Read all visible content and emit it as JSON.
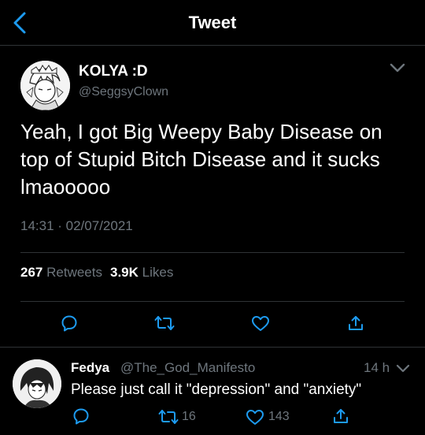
{
  "header": {
    "title": "Tweet"
  },
  "tweet": {
    "author_name": "KOLYA :D",
    "author_handle": "@SeggsyClown",
    "text": "Yeah, I got Big Weepy Baby Disease on top of Stupid Bitch Disease and it sucks lmaooooo",
    "time": "14:31 · 02/07/2021",
    "retweets_count": "267",
    "retweets_label": "Retweets",
    "likes_count": "3.9K",
    "likes_label": "Likes"
  },
  "reply": {
    "author_name": "Fedya",
    "author_handle": "@The_God_Manifesto",
    "time": "14 h",
    "text": "Please just call it \"depression\" and \"anxiety\"",
    "retweets": "16",
    "likes": "143"
  },
  "icons": {
    "back": "chevron-left-icon",
    "more": "chevron-down-icon",
    "reply": "reply-icon",
    "retweet": "retweet-icon",
    "like": "heart-icon",
    "share": "share-icon"
  },
  "colors": {
    "background": "#000000",
    "accent": "#1d9bf0",
    "muted": "#6e767d",
    "divider": "#2f3336"
  }
}
